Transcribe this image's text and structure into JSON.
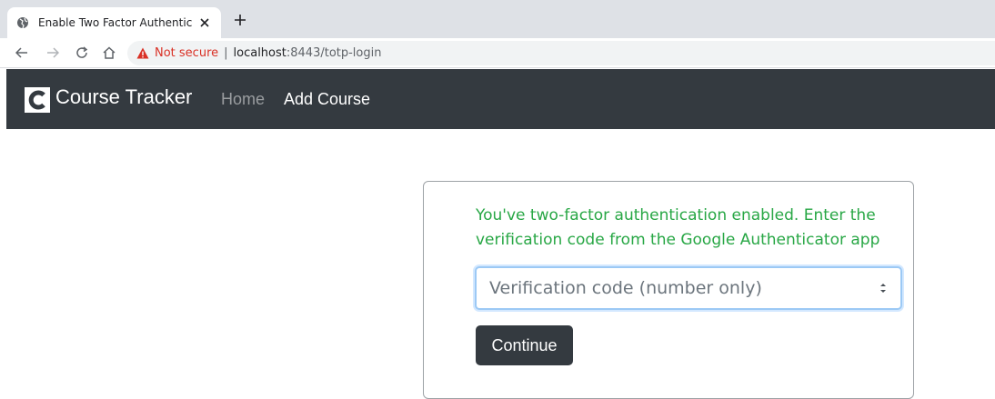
{
  "browser": {
    "tab_title": "Enable Two Factor Authentication",
    "security_label": "Not secure",
    "separator": "|",
    "url_host": "localhost",
    "url_path": ":8443/totp-login"
  },
  "navbar": {
    "brand": "Course Tracker",
    "links": [
      {
        "label": "Home"
      },
      {
        "label": "Add Course"
      }
    ]
  },
  "card": {
    "message": "You've two-factor authentication enabled. Enter the verification code from the Google Authenticator app",
    "input_placeholder": "Verification code (number only)",
    "button_label": "Continue"
  },
  "colors": {
    "navbar_bg": "#343a40",
    "message_text": "#28a745",
    "security_warning": "#d93025",
    "input_focus": "#9cc9f5"
  },
  "icons": {
    "tab_favicon": "globe-icon",
    "tab_close": "close-icon",
    "new_tab": "plus-icon",
    "back": "back-arrow-icon",
    "forward": "forward-arrow-icon",
    "reload": "reload-icon",
    "home": "home-icon",
    "warning": "warning-triangle-icon",
    "brand_logo": "course-tracker-logo-icon",
    "spinner": "number-spinner-icon"
  }
}
